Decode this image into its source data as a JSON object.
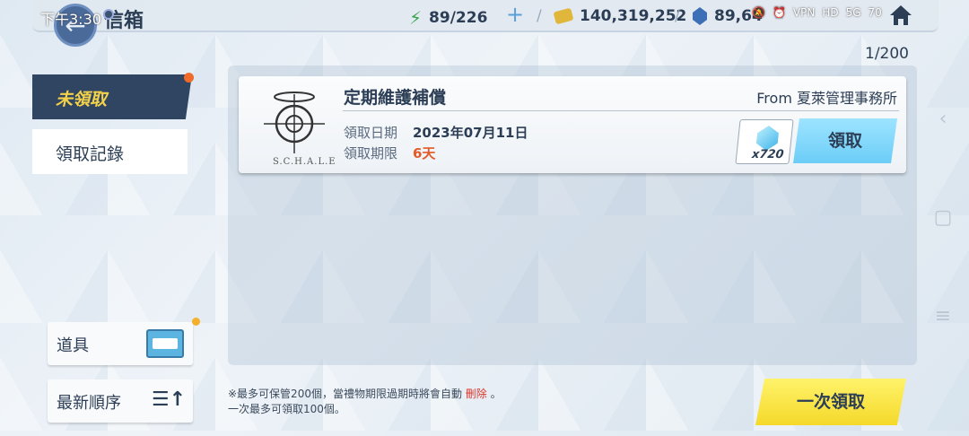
{
  "status_bar": {
    "time": "下午3:30",
    "battery": "70",
    "network": "5G"
  },
  "header": {
    "title": "信箱"
  },
  "resources": {
    "ap": "89/226",
    "credits": "140,319,252",
    "pyroxene": "89,64"
  },
  "mailbox": {
    "count": "1/200"
  },
  "tabs": {
    "unclaimed": "未領取",
    "history": "領取記錄"
  },
  "side_buttons": {
    "items": "道具",
    "sort": "最新順序"
  },
  "mail": {
    "title": "定期維護補償",
    "from": "From 夏萊管理事務所",
    "logo_text": "S.C.H.A.L.E",
    "date_label": "領取日期",
    "date_value": "2023年07月11日",
    "limit_label": "領取期限",
    "limit_value": "6天",
    "reward_qty": "x720",
    "claim_label": "領取"
  },
  "footnote": {
    "line1_prefix": "※最多可保管200個，當禮物期限過期時將會自動",
    "line1_delete": "刪除",
    "line1_suffix": "。",
    "line2": "一次最多可領取100個。"
  },
  "claim_all_label": "一次領取",
  "colors": {
    "accent_red": "#e35a28",
    "tab_active_bg": "#2f4562",
    "tab_active_text": "#f4d24a",
    "claim_btn": "#6ccdf7",
    "claim_all_btn": "#f5d92a"
  }
}
